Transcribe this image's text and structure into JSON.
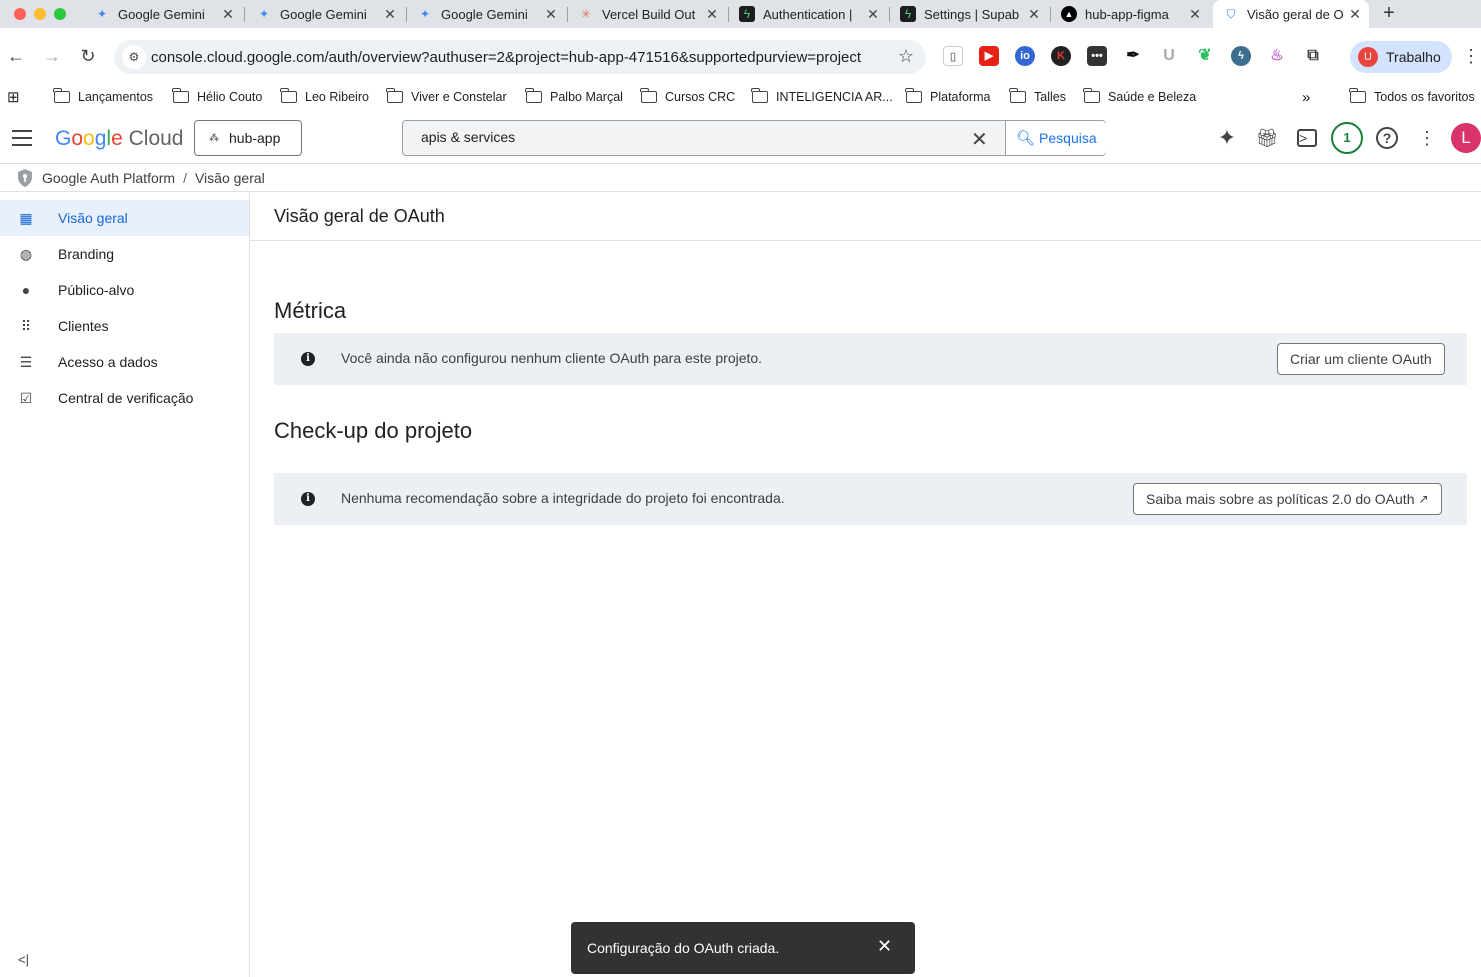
{
  "browser": {
    "tabs": [
      {
        "title": "Google Gemini",
        "icon": "gemini-icon",
        "color": "#4285f4"
      },
      {
        "title": "Google Gemini",
        "icon": "gemini-icon",
        "color": "#4285f4"
      },
      {
        "title": "Google Gemini",
        "icon": "gemini-icon",
        "color": "#4285f4"
      },
      {
        "title": "Vercel Build Out",
        "icon": "claude-icon",
        "color": "#d97757"
      },
      {
        "title": "Authentication |",
        "icon": "supabase-icon",
        "color": "#3ecf8e"
      },
      {
        "title": "Settings | Supab",
        "icon": "supabase-icon",
        "color": "#3ecf8e"
      },
      {
        "title": "hub-app-figma",
        "icon": "vercel-icon",
        "color": "#000000"
      },
      {
        "title": "Visão geral de O",
        "icon": "shield-icon",
        "color": "#4285f4"
      }
    ],
    "url": "console.cloud.google.com/auth/overview?authuser=2&project=hub-app-471516&supportedpurview=project",
    "profile": {
      "initial": "U",
      "name": "Trabalho"
    },
    "bookmarks": [
      "Lançamentos",
      "Hélio Couto",
      "Leo Ribeiro",
      "Viver e Constelar",
      "Palbo Marçal",
      "Cursos CRC",
      "INTELIGENCIA AR...",
      "Plataforma",
      "Talles",
      "Saúde e Beleza"
    ],
    "all_bookmarks": "Todos os favoritos"
  },
  "console": {
    "logo": {
      "google": "Google",
      "cloud": "Cloud"
    },
    "project": "hub-app",
    "search": {
      "value": "apis & services",
      "button": "Pesquisa"
    },
    "notifications": "1",
    "user_initial": "L",
    "breadcrumb": {
      "root": "Google Auth Platform",
      "current": "Visão geral"
    },
    "sidebar": [
      {
        "label": "Visão geral",
        "icon": "dashboard-icon",
        "glyph": "▦",
        "active": true
      },
      {
        "label": "Branding",
        "icon": "palette-icon",
        "glyph": "◍"
      },
      {
        "label": "Público-alvo",
        "icon": "person-icon",
        "glyph": "●"
      },
      {
        "label": "Clientes",
        "icon": "apps-grid-icon",
        "glyph": "⠿"
      },
      {
        "label": "Acesso a dados",
        "icon": "data-access-icon",
        "glyph": "☰"
      },
      {
        "label": "Central de verificação",
        "icon": "verified-checkbox-icon",
        "glyph": "☑"
      }
    ],
    "collapse": "<|"
  },
  "main": {
    "page_title": "Visão geral de OAuth",
    "metrics": {
      "title": "Métrica",
      "message": "Você ainda não configurou nenhum cliente OAuth para este projeto.",
      "button": "Criar um cliente OAuth"
    },
    "checkup": {
      "title": "Check-up do projeto",
      "message": "Nenhuma recomendação sobre a integridade do projeto foi encontrada.",
      "button": "Saiba mais sobre as políticas 2.0 do OAuth"
    }
  },
  "toast": {
    "message": "Configuração do OAuth criada."
  },
  "colors": {
    "accent": "#1a73e8",
    "active_bg": "#e8f0fe",
    "banner_bg": "#eceff3",
    "toast_bg": "#323232"
  }
}
